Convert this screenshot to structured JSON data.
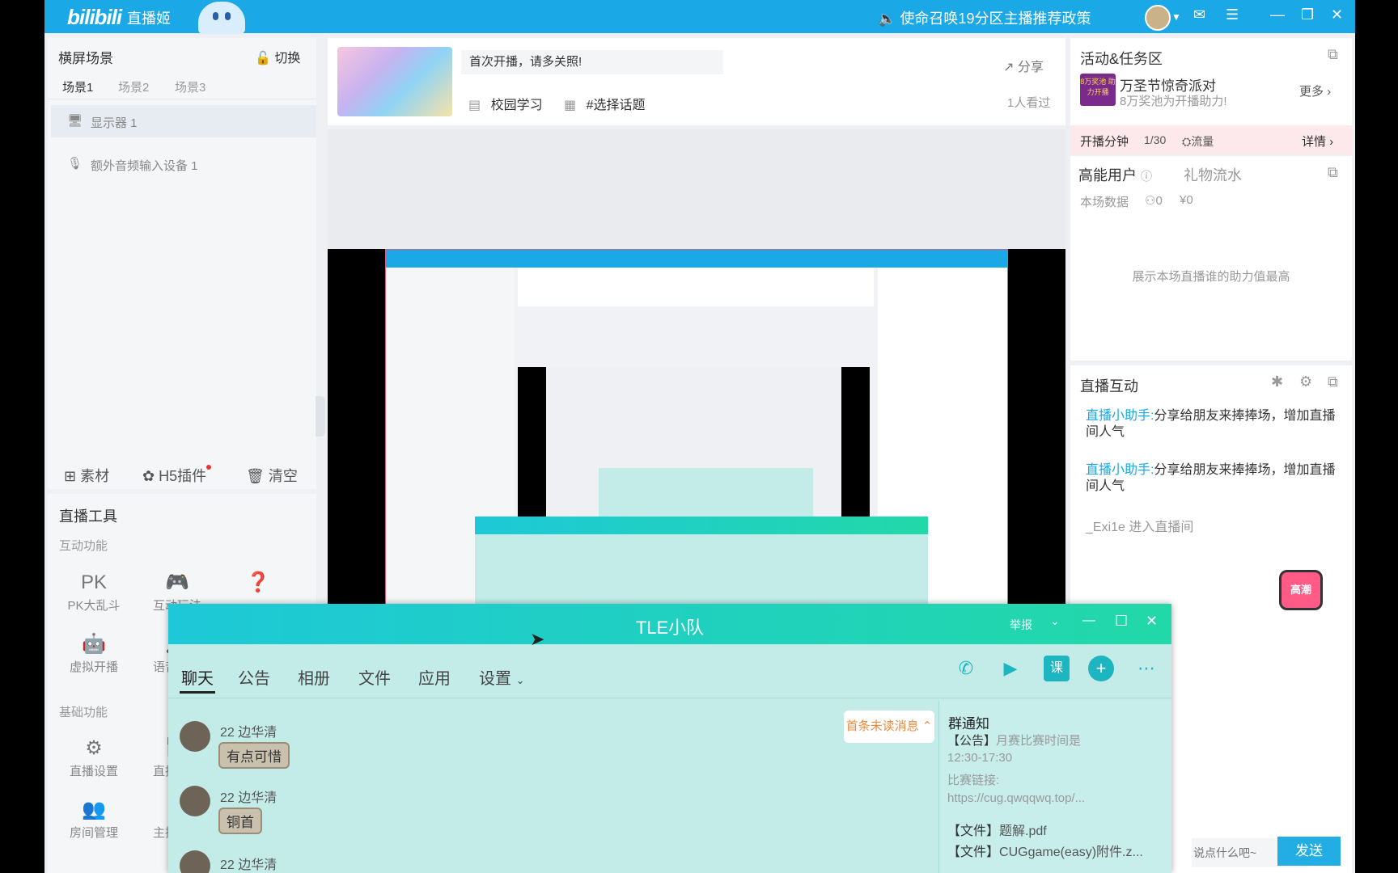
{
  "app": {
    "logo": "bilibili",
    "subtitle": "直播姬",
    "notice": "使命召唤19分区主播推荐政策"
  },
  "scene": {
    "title": "横屏场景",
    "switch_label": "切换",
    "tabs": [
      "场景1",
      "场景2",
      "场景3"
    ],
    "sources": [
      "显示器 1",
      "额外音频输入设备 1"
    ],
    "actions": [
      "素材",
      "H5插件",
      "清空"
    ]
  },
  "tools": {
    "title": "直播工具",
    "interactive_label": "互动功能",
    "interactive_items": [
      "PK大乱斗",
      "互动玩法",
      "虚拟开播",
      "语音连麦"
    ],
    "basic_label": "基础功能",
    "basic_items": [
      "直播设置",
      "直播预约",
      "房间管理",
      "主播公告"
    ]
  },
  "stream": {
    "announcement": "首次开播，请多关照!",
    "share": "分享",
    "category": "校园学习",
    "topic": "#选择话题",
    "viewers": "1人看过"
  },
  "activity": {
    "title": "活动&任务区",
    "event_name": "万圣节惊奇派对",
    "event_desc": "8万奖池为开播助力!",
    "badge_text": "8万奖池 助力开播",
    "more": "更多",
    "mission_label": "开播分钟",
    "mission_progress": "1/30",
    "mission_reward": "流量",
    "details": "详情"
  },
  "high_energy": {
    "tab1": "高能用户",
    "tab2": "礼物流水",
    "stats_label": "本场数据",
    "users": "0",
    "money": "¥0",
    "empty": "展示本场直播谁的助力值最高"
  },
  "interaction": {
    "title": "直播互动",
    "messages": [
      {
        "sender": "直播小助手:",
        "text": "分享给朋友来捧捧场，增加直播间人气"
      },
      {
        "sender": "直播小助手:",
        "text": "分享给朋友来捧捧场，增加直播间人气"
      }
    ],
    "entry": "_Exi1e 进入直播间",
    "send": "发送",
    "input_placeholder": "说点什么吧~",
    "hd_badge": "高潮"
  },
  "qq": {
    "title": "TLE小队",
    "report": "举报",
    "tabs": [
      "聊天",
      "公告",
      "相册",
      "文件",
      "应用",
      "设置"
    ],
    "unread": "首条未读消息",
    "messages": [
      {
        "name": "22 边华清",
        "text": "有点可惜"
      },
      {
        "name": "22 边华清",
        "text": "铜首"
      },
      {
        "name": "22 边华清",
        "text": ""
      }
    ],
    "notice_title": "群通知",
    "notice_lines": [
      {
        "tag": "【公告】",
        "text": "月赛比赛时间是"
      },
      {
        "tag": "",
        "text": "12:30-17:30"
      },
      {
        "tag": "",
        "text": "比赛链接:"
      },
      {
        "tag": "",
        "text": "https://cug.qwqqwq.top/..."
      },
      {
        "tag": "【文件】",
        "text": "题解.pdf"
      },
      {
        "tag": "【文件】",
        "text": "CUGgame(easy)附件.z..."
      }
    ]
  },
  "colors": {
    "brand": "#1ba8e6",
    "panel": "#f5f6f8",
    "qq_header": "#1ec8d8",
    "qq_body": "#c3ece9"
  }
}
